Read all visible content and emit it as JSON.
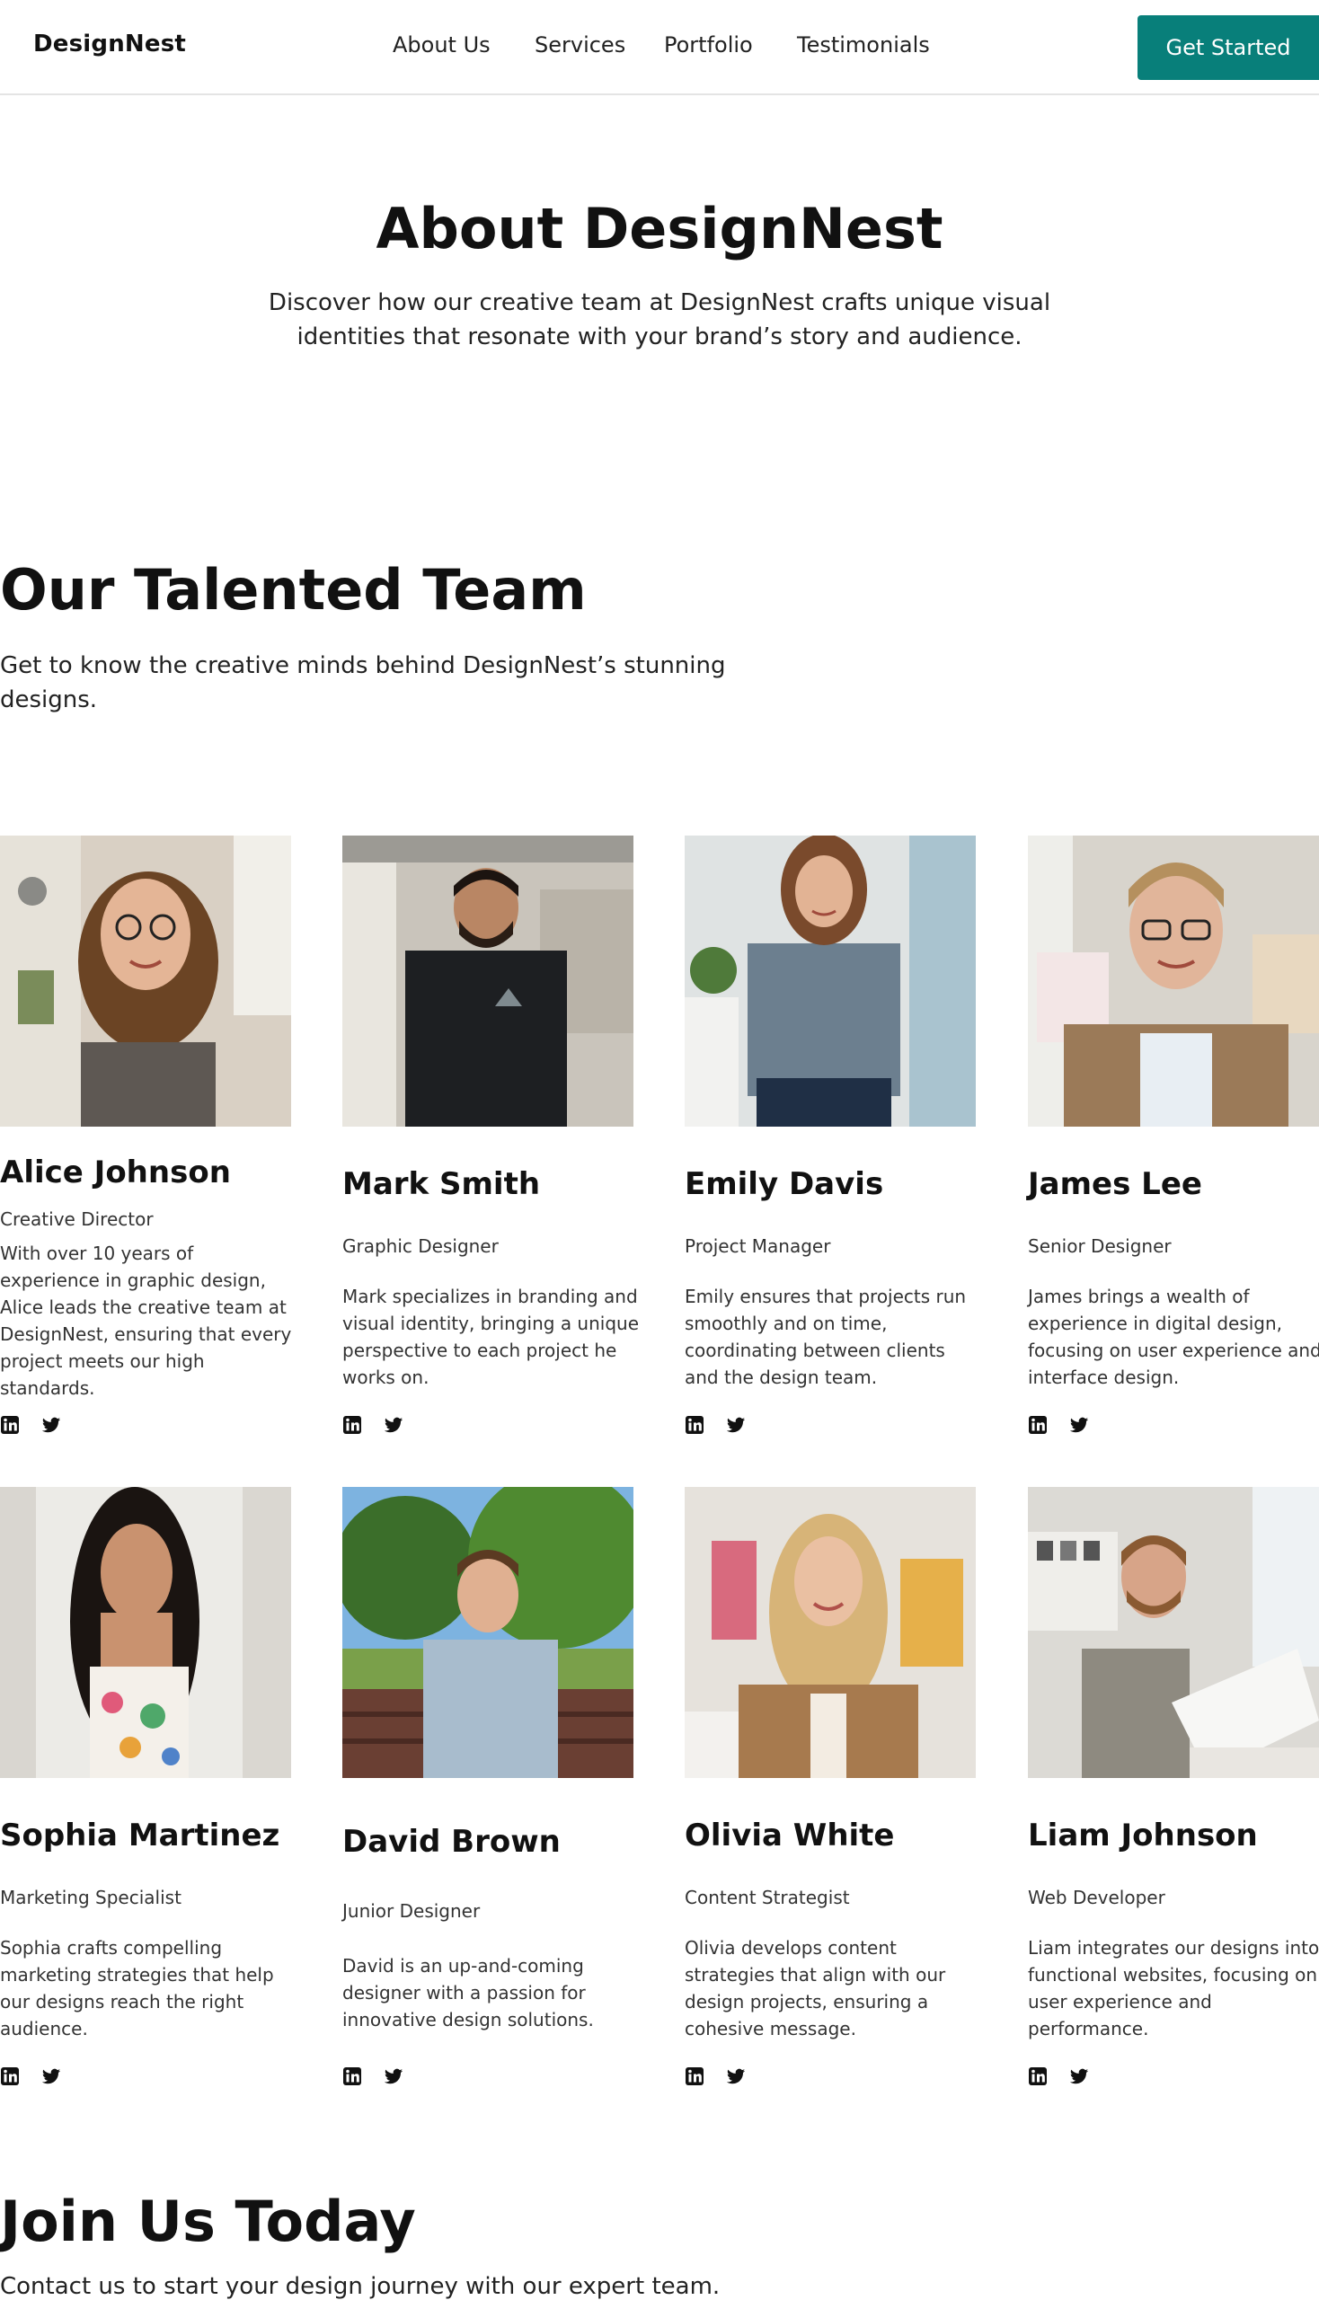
{
  "nav": {
    "logo": "DesignNest",
    "links": [
      "About Us",
      "Services",
      "Portfolio",
      "Testimonials"
    ],
    "cta": "Get Started",
    "cta_color": "#087f7a"
  },
  "hero": {
    "title": "About DesignNest",
    "subtitle": "Discover how our creative team at DesignNest crafts unique visual identities that resonate with your brand’s story and audience."
  },
  "team": {
    "title": "Our Talented Team",
    "subtitle": "Get to know the creative minds behind DesignNest’s stunning designs.",
    "members": [
      {
        "name": "Alice Johnson",
        "role": "Creative Director",
        "bio": "With over 10 years of experience in graphic design, Alice leads the creative team at DesignNest, ensuring that every project meets our high standards.",
        "photo": "woman-with-glasses-portrait"
      },
      {
        "name": "Mark Smith",
        "role": "Graphic Designer",
        "bio": "Mark specializes in branding and visual identity, bringing a unique perspective to each project he works on.",
        "photo": "bearded-man-in-studio"
      },
      {
        "name": "Emily Davis",
        "role": "Project Manager",
        "bio": "Emily ensures that projects run smoothly and on time, coordinating between clients and the design team.",
        "photo": "woman-in-office"
      },
      {
        "name": "James Lee",
        "role": "Senior Designer",
        "bio": "James brings a wealth of experience in digital design, focusing on user experience and interface design.",
        "photo": "man-with-glasses-in-studio"
      },
      {
        "name": "Sophia Martinez",
        "role": "Marketing Specialist",
        "bio": "Sophia crafts compelling marketing strategies that help our designs reach the right audience.",
        "photo": "woman-long-dark-hair"
      },
      {
        "name": "David Brown",
        "role": "Junior Designer",
        "bio": "David is an up-and-coming designer with a passion for innovative design solutions.",
        "photo": "young-man-in-park"
      },
      {
        "name": "Olivia White",
        "role": "Content Strategist",
        "bio": "Olivia develops content strategies that align with our design projects, ensuring a cohesive message.",
        "photo": "blonde-woman-in-office"
      },
      {
        "name": "Liam Johnson",
        "role": "Web Developer",
        "bio": "Liam integrates our designs into functional websites, focusing on user experience and performance.",
        "photo": "man-reviewing-papers"
      }
    ],
    "social_icons": [
      "linkedin-icon",
      "twitter-icon"
    ]
  },
  "join": {
    "title": "Join Us Today",
    "subtitle": "Contact us to start your design journey with our expert team."
  }
}
